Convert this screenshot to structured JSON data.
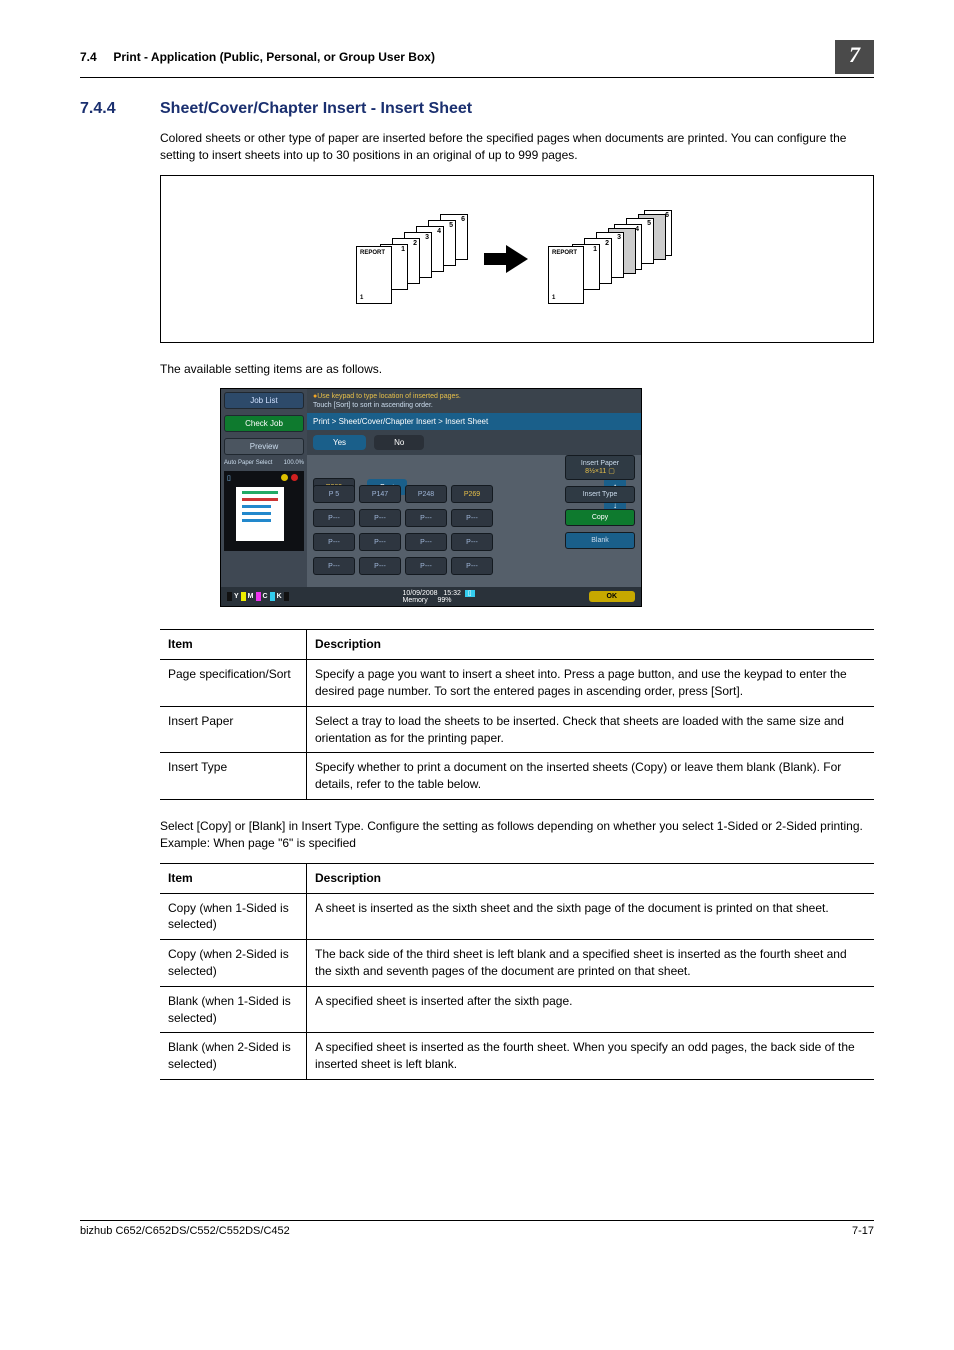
{
  "header": {
    "section_ref": "7.4",
    "section_title": "Print - Application (Public, Personal, or Group User Box)",
    "chapter_badge": "7"
  },
  "section": {
    "number": "7.4.4",
    "title": "Sheet/Cover/Chapter Insert - Insert Sheet"
  },
  "para1": "Colored sheets or other type of paper are inserted before the specified pages when documents are printed. You can configure the setting to insert sheets into up to 30 positions in an original of up to 999 pages.",
  "para2": "The available setting items are as follows.",
  "diagram": {
    "report_label": "REPORT",
    "bottom_num": "1",
    "nums": [
      "1",
      "2",
      "3",
      "4",
      "5",
      "6"
    ]
  },
  "screenshot": {
    "sidebar": {
      "job_list": "Job List",
      "check_job": "Check Job",
      "preview": "Preview",
      "auto_paper": "Auto Paper Select",
      "pct": "100.0%"
    },
    "hint_l1": "Use keypad to type location of inserted pages.",
    "hint_l2": "Touch [Sort] to sort in ascending order.",
    "breadcrumb": "Print > Sheet/Cover/Chapter Insert > Insert Sheet",
    "yes": "Yes",
    "no": "No",
    "cells_row1": [
      "P269"
    ],
    "sort": "Sort",
    "count": "1 / 2",
    "cells_row2": [
      "P  5",
      "P147",
      "P248",
      "P269"
    ],
    "empty": "P---",
    "right": {
      "insert_paper": "Insert Paper",
      "paper_val": "8½×11 ▢",
      "insert_type": "Insert Type",
      "copy": "Copy",
      "blank": "Blank"
    },
    "footer": {
      "toner_labels": [
        "Y",
        "M",
        "C",
        "K"
      ],
      "date": "10/09/2008",
      "time": "15:32",
      "memory": "Memory",
      "mem_val": "99%",
      "ok": "OK"
    }
  },
  "table1": {
    "h1": "Item",
    "h2": "Description",
    "rows": [
      {
        "item": "Page specification/Sort",
        "desc": "Specify a page you want to insert a sheet into. Press a page button, and use the keypad to enter the desired page number. To sort the entered pages in ascending order, press [Sort]."
      },
      {
        "item": "Insert Paper",
        "desc": "Select a tray to load the sheets to be inserted. Check that sheets are loaded with the same size and orientation as for the printing paper."
      },
      {
        "item": "Insert Type",
        "desc": "Specify whether to print a document on the inserted sheets (Copy) or leave them blank (Blank). For details, refer to the table below."
      }
    ]
  },
  "para3": "Select [Copy] or [Blank] in Insert Type. Configure the setting as follows depending on whether you select 1-Sided or 2-Sided printing. Example: When page \"6\" is specified",
  "table2": {
    "h1": "Item",
    "h2": "Description",
    "rows": [
      {
        "item": "Copy (when 1-Sided is selected)",
        "desc": "A sheet is inserted as the sixth sheet and the sixth page of the document is printed on that sheet."
      },
      {
        "item": "Copy (when 2-Sided is selected)",
        "desc": "The back side of the third sheet is left blank and a specified sheet is inserted as the fourth sheet and the sixth and seventh pages of the document are printed on that sheet."
      },
      {
        "item": "Blank (when 1-Sided is selected)",
        "desc": "A specified sheet is inserted after the sixth page."
      },
      {
        "item": "Blank (when 2-Sided is selected)",
        "desc": "A specified sheet is inserted as the fourth sheet. When you specify an odd pages, the back side of the inserted sheet is left blank."
      }
    ]
  },
  "footer": {
    "model": "bizhub C652/C652DS/C552/C552DS/C452",
    "page": "7-17"
  }
}
